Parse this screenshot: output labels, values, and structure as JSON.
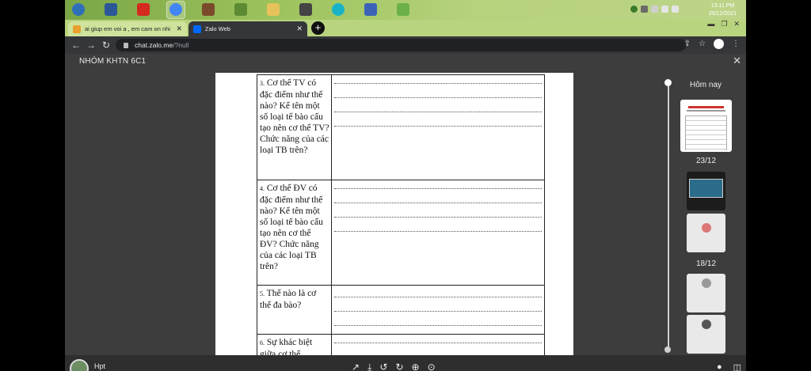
{
  "taskbar": {
    "clock_time": "13:11 PM",
    "clock_date": "25/12/2021",
    "apps": [
      {
        "icon": "start-orb-icon",
        "color": "#2f6fb8"
      },
      {
        "icon": "word-icon",
        "color": "#2b5797"
      },
      {
        "icon": "opera-icon",
        "color": "#d42a1f"
      },
      {
        "icon": "chrome-icon",
        "color": "#4285f4"
      },
      {
        "icon": "game-icon",
        "color": "#7b4a2a"
      },
      {
        "icon": "minecraft-icon",
        "color": "#5b8a32"
      },
      {
        "icon": "folder-icon",
        "color": "#e7c25a"
      },
      {
        "icon": "game2-icon",
        "color": "#444444"
      },
      {
        "icon": "browser-icon",
        "color": "#19b3c8"
      },
      {
        "icon": "control-panel-icon",
        "color": "#3a63b8"
      },
      {
        "icon": "game3-icon",
        "color": "#6cb04a"
      }
    ]
  },
  "tabs": [
    {
      "title": "ai giup em voi a , em cam on nhi",
      "favicon_color": "#e8a12a"
    },
    {
      "title": "Zalo Web",
      "favicon_color": "#0068ff"
    }
  ],
  "address": {
    "host": "chat.zalo.me",
    "path": "/?null"
  },
  "viewer": {
    "title": "NHÓM KHTN 6C1"
  },
  "document": {
    "rows": [
      {
        "num": "3.",
        "question": "Cơ thể TV có đặc điểm như thế nào? Kể tên một số loại tế bào cấu tạo nên cơ thể TV? Chức năng của các loại TB trên?",
        "dot_lines": 4
      },
      {
        "num": "4.",
        "question": "Cơ thể ĐV có đặc điểm như thế nào? Kể tên một số loại tế bào cấu tạo nên cơ thể ĐV? Chức năng của các loại TB trên?",
        "dot_lines": 4
      },
      {
        "num": "5.",
        "question": "Thế nào là cơ thể đa bào?",
        "dot_lines": 3
      },
      {
        "num": "6.",
        "question": "Sự khác biệt giữa cơ thể",
        "dot_lines": 1
      }
    ]
  },
  "timeline": {
    "groups": [
      {
        "label": "Hôm nay"
      },
      {
        "label": "23/12"
      },
      {
        "label": "18/12"
      }
    ]
  },
  "bottom": {
    "sender": "Hpt"
  }
}
